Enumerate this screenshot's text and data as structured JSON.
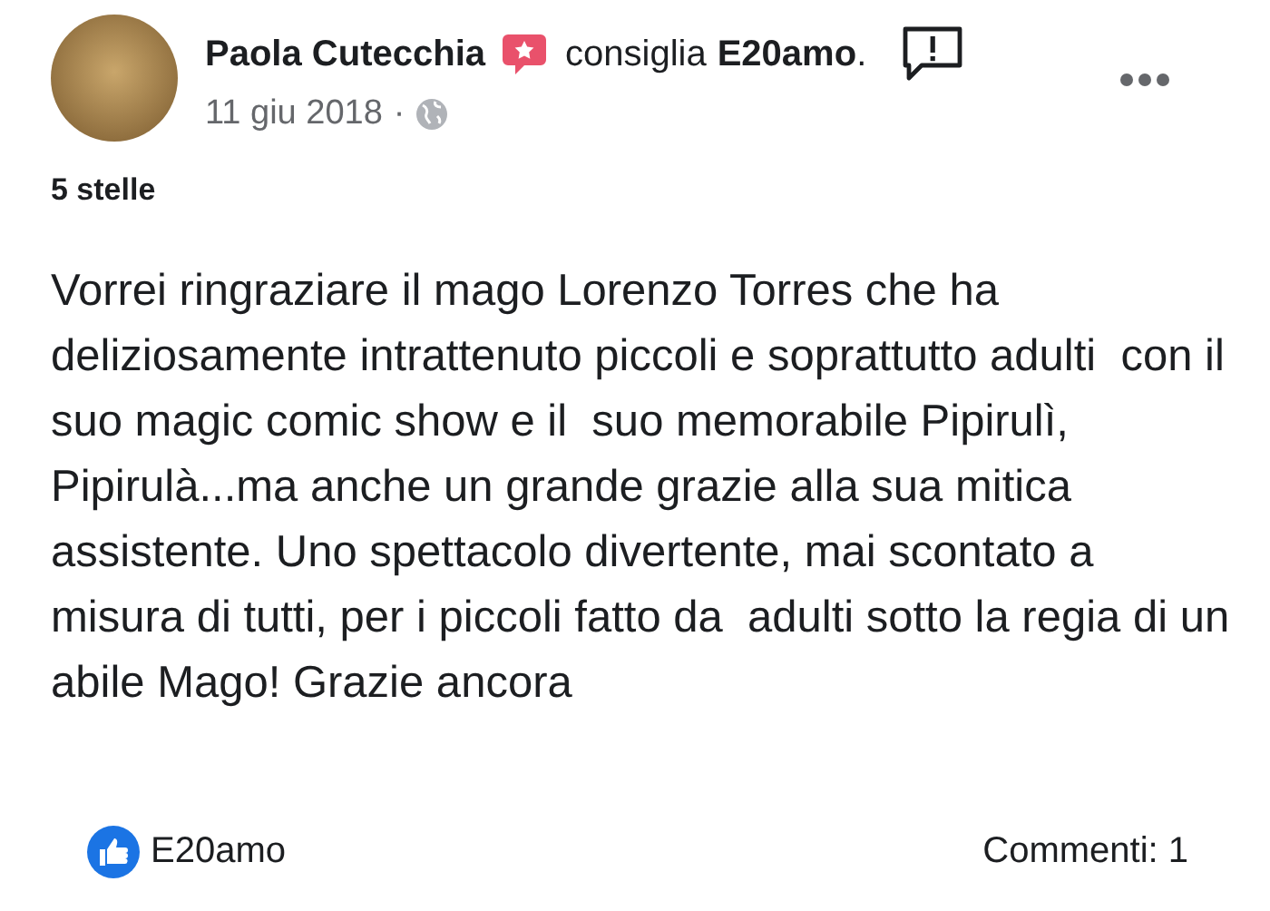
{
  "post": {
    "author": "Paola Cutecchia",
    "action": "consiglia",
    "page": "E20amo",
    "page_suffix": ".",
    "date": "11 giu 2018",
    "separator": "·"
  },
  "rating": "5 stelle",
  "body": "Vorrei ringraziare il mago Lorenzo Torres che ha deliziosamente intrattenuto piccoli e soprattutto adulti  con il suo magic comic show e il  suo memorabile Pipirulì, Pipirulà...ma anche un grande grazie alla sua mitica assistente. Uno spettacolo divertente, mai scontato a misura di tutti, per i piccoli fatto da  adulti sotto la regia di un abile Mago! Grazie ancora",
  "footer": {
    "reactions": "E20amo",
    "comments": "Commenti: 1"
  }
}
